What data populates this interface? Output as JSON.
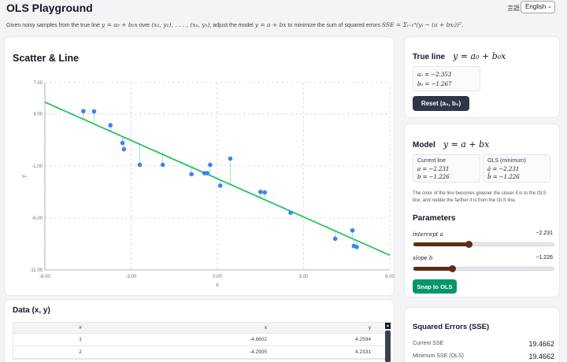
{
  "header": {
    "title": "OLS Playground",
    "lang_label": "言語",
    "lang_value": "English",
    "subtitle_a": "Given noisy samples from the true line ",
    "subtitle_eq1": "y = a₀ + b₀x",
    "subtitle_b": " over ",
    "subtitle_pts": "(x₁, y₁), . . . , (xₙ, yₙ)",
    "subtitle_c": ", adjust the model ",
    "subtitle_eq2": "y = a + bx",
    "subtitle_d": " to minimize the sum of squared errors ",
    "subtitle_eq3": "SSE = Σᵢ₌₁ⁿ(yᵢ − (a + bxᵢ))²."
  },
  "scatter": {
    "title": "Scatter & Line",
    "xlabel": "x",
    "ylabel": "y"
  },
  "chart_data": {
    "type": "scatter",
    "title": "Scatter & Line",
    "xlabel": "x",
    "ylabel": "y",
    "xlim": [
      -6,
      6
    ],
    "ylim": [
      -11,
      7
    ],
    "xticks": [
      "-6.00",
      "-3.00",
      "0.00",
      "3.00",
      "6.00"
    ],
    "yticks": [
      "7.00",
      "4.00",
      "-1.00",
      "-6.00",
      "-11.00"
    ],
    "grid": true,
    "line": {
      "intercept": -2.231,
      "slope": -1.226,
      "color": "#22c55e"
    },
    "points": {
      "x": [
        -4.6602,
        -4.2905,
        -3.72,
        -3.3,
        -3.25,
        -2.7,
        -1.9,
        -0.9,
        -0.45,
        -0.35,
        -0.25,
        0.1,
        0.45,
        1.5,
        1.65,
        2.55,
        4.1,
        4.7,
        4.75,
        4.85
      ],
      "y": [
        4.2594,
        4.2331,
        2.9,
        1.2,
        0.6,
        -0.9,
        -0.9,
        -1.8,
        -1.7,
        -1.7,
        -0.9,
        -2.9,
        -0.3,
        -3.5,
        -3.55,
        -5.5,
        -8.0,
        -7.2,
        -8.7,
        -8.8
      ]
    },
    "point_color": "#3b82f6"
  },
  "data_table": {
    "title": "Data (x, y)",
    "headers": [
      "#",
      "x",
      "y"
    ],
    "rows": [
      [
        "1",
        "-4.6602",
        "4.2594"
      ],
      [
        "2",
        "-4.2905",
        "4.2331"
      ]
    ]
  },
  "true_line": {
    "title": "True line",
    "equation": "y = a₀ + b₀x",
    "a0": "a₀ = −2.353",
    "b0": "b₀ = −1.267",
    "reset_label": "Reset  (a₀, b₀)"
  },
  "model": {
    "title": "Model",
    "equation": "y = a + bx",
    "current_label": "Current line",
    "current_a": "a = −2.231",
    "current_b": "b = −1.226",
    "ols_label": "OLS (minimum)",
    "ols_a": "â = −2.231",
    "ols_b": "b̂ = −1.226",
    "color_note": "The color of the line becomes greener the closer it is to the OLS line, and redder the farther it is from the OLS line.",
    "params_title": "Parameters",
    "intercept_label": "intercept a",
    "intercept_value": "−2.231",
    "intercept_fraction": 0.39,
    "slope_label": "slope b",
    "slope_value": "−1.226",
    "slope_fraction": 0.27,
    "snap_label": "Snap to OLS"
  },
  "sse": {
    "title": "Squared Errors (SSE)",
    "current_label": "Current SSE",
    "current_value": "19.4662",
    "min_label": "Minimum SSE (OLS)",
    "min_value": "19.4662"
  },
  "colors": {
    "line_green": "#22c55e",
    "points_blue": "#3b82f6",
    "reset_dark": "#2d3748",
    "snap_green": "#059669",
    "slider_brown": "#5b2e12"
  }
}
